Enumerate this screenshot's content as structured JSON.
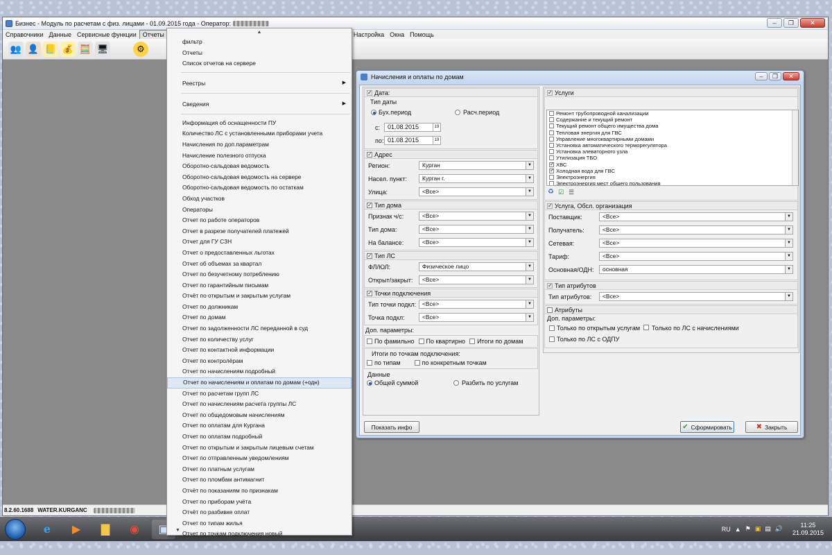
{
  "window": {
    "title": "Бизнес - Модуль по расчетам с физ. лицами - 01.09.2015 года - Оператор:"
  },
  "menubar": {
    "items": [
      "Справочники",
      "Данные",
      "Сервисные функции",
      "Отчеты",
      "Настройка",
      "Окна",
      "Помощь"
    ]
  },
  "toolbar": {
    "icons": [
      "users-icon",
      "operator-icon",
      "book-icon",
      "money-icon",
      "calculator-icon",
      "computer-icon",
      "settings-gear-icon"
    ]
  },
  "statusbar": {
    "version": "8.2.60.1688",
    "server": "WATER.KURGANC"
  },
  "reports_menu": {
    "group1": [
      "фильтр",
      "Отчеты",
      "Список отчетов на сервере"
    ],
    "submenus": [
      "Реестры",
      "Сведения"
    ],
    "items": [
      "Информация об оснащенности ПУ",
      "Количество ЛС с установленными приборами учета",
      "Начисления по доп.параметрам",
      "Начисление полезного отпуска",
      "Оборотно-сальдовая ведомость",
      "Оборотно-сальдовая ведомость на сервере",
      "Оборотно-сальдовая ведомость по остаткам",
      "Обход участков",
      "Операторы",
      "Отчет по работе операторов",
      "Отчет в разрезе получателей платежей",
      "Отчет для ГУ СЗН",
      "Отчет о предоставленных льготах",
      "Отчет об объемах за квартал",
      "Отчет по безучетному потреблению",
      "Отчет по гарантийным письмам",
      "Отчёт по открытым и закрытым услугам",
      "Отчет по должникам",
      "Отчет по домам",
      "Отчет по задолженности ЛС переданной в суд",
      "Отчет по количеству услуг",
      "Отчет по контактной информации",
      "Отчет по контролёрам",
      "Отчет по начислениям подробный",
      "Отчет по начислениям и оплатам по домам (+одн)",
      "Отчет по расчетам групп ЛС",
      "Отчет по начислениям расчета группы ЛС",
      "Отчет по общедомовым начислениям",
      "Отчет по оплатам для Кургана",
      "Отчет по оплатам подробный",
      "Отчет по открытым и закрытым лицевым счетам",
      "Отчет по отправленным уведомлениям",
      "Отчет по платным услугам",
      "Отчет по пломбам антимагнит",
      "Отчёт по показаниям по признакам",
      "Отчет по приборам учёта",
      "Отчёт по разбивке оплат",
      "Отчет по типам жилья",
      "Отчет по точкам подключения новый"
    ],
    "highlighted_index": 24
  },
  "dialog": {
    "title": "Начисления и оплаты по домам",
    "date_group": {
      "label": "Дата:",
      "type_label": "Тип даты",
      "radio_buh": "Бух.период",
      "radio_rasch": "Расч.период",
      "from_label": "с:",
      "from_value": "01.08.2015",
      "to_label": "по:",
      "to_value": "01.08.2015"
    },
    "address_group": {
      "label": "Адрес",
      "region_label": "Регион:",
      "region_value": "Курган",
      "city_label": "Насел. пункт:",
      "city_value": "Курган г.",
      "street_label": "Улица:",
      "street_value": "<Все>"
    },
    "house_type_group": {
      "label": "Тип дома",
      "ch_label": "Признак ч/с:",
      "ch_value": "<Все>",
      "type_label": "Тип дома:",
      "type_value": "<Все>",
      "balance_label": "На балансе:",
      "balance_value": "<Все>"
    },
    "ls_type_group": {
      "label": "Тип ЛС",
      "fl_label": "ФЛ/ЮЛ:",
      "fl_value": "Физическое лицо",
      "open_label": "Открыт/закрыт:",
      "open_value": "<Все>"
    },
    "points_group": {
      "label": "Точки подключения",
      "type_label": "Тип точки подкл:",
      "type_value": "<Все>",
      "point_label": "Точка подкл:",
      "point_value": "<Все>"
    },
    "extra_params": {
      "label": "Доп. параметры:",
      "by_surname": "По фамильно",
      "by_apartment": "По квартирно",
      "totals_by_house": "Итоги по домам"
    },
    "points_totals": {
      "label": "Итоги по точкам подключения:",
      "by_types": "по типам",
      "by_specific": "по конкретным точкам"
    },
    "data_group": {
      "label": "Данные",
      "total_sum": "Общей суммой",
      "by_services": "Разбить по услугам"
    },
    "services": {
      "label": "Услуги",
      "items": [
        {
          "name": "Ремонт трубопроводной канализации",
          "checked": false
        },
        {
          "name": "Содержание и текущий ремонт",
          "checked": false
        },
        {
          "name": "Текущий ремонт общего имущества дома",
          "checked": false
        },
        {
          "name": "Тепловая энергия для ГВС",
          "checked": false
        },
        {
          "name": "Управление многоквартирными домами",
          "checked": false
        },
        {
          "name": "Установка автоматического терморегулятора",
          "checked": false
        },
        {
          "name": "Установка элеваторного узла",
          "checked": false
        },
        {
          "name": "Утилизация ТБО",
          "checked": false
        },
        {
          "name": "ХВС",
          "checked": true
        },
        {
          "name": "Холодная вода для ГВС",
          "checked": true
        },
        {
          "name": "Электроэнергия",
          "checked": false
        },
        {
          "name": "Электроэнергия мест общего пользования",
          "checked": false
        }
      ]
    },
    "service_org": {
      "label": "Услуга, Обсл. организация",
      "supplier_label": "Поставщик:",
      "supplier_value": "<Все>",
      "recipient_label": "Получатель:",
      "recipient_value": "<Все>",
      "network_label": "Сетевая:",
      "network_value": "<Все>",
      "tariff_label": "Тариф:",
      "tariff_value": "<Все>",
      "main_label": "Основная/ОДН:",
      "main_value": "основная"
    },
    "attr_types": {
      "label": "Тип атрибутов",
      "type_label": "Тип атрибутов:",
      "type_value": "<Все>"
    },
    "attributes": {
      "label": "Атрибуты",
      "extra_label": "Доп. параметры:",
      "only_open": "Только по открытым услугам",
      "only_charged": "Только по ЛС с начислениями",
      "only_odpu": "Только по ЛС с ОДПУ"
    },
    "buttons": {
      "show_info": "Показать инфо",
      "generate": "Сформировать",
      "close": "Закрыть"
    }
  },
  "taskbar": {
    "lang": "RU",
    "time": "11:25",
    "date": "21.09.2015"
  }
}
